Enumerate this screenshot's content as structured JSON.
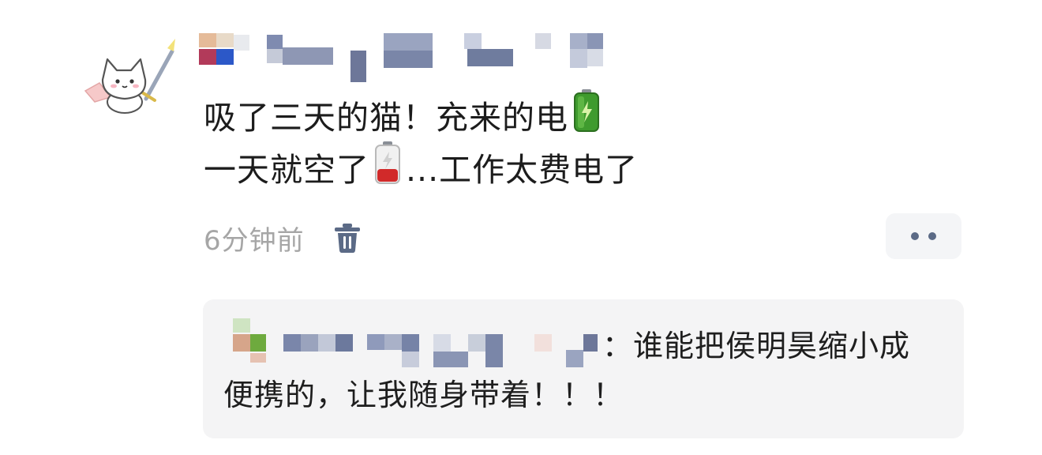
{
  "post": {
    "content_line1": "吸了三天的猫！充来的电",
    "content_line2_a": "一天就空了",
    "content_line2_b": "...工作太费电了",
    "timestamp": "6分钟前"
  },
  "icons": {
    "avatar": "cat-knight-avatar",
    "emoji_full": "battery-full-icon",
    "emoji_low": "battery-low-icon",
    "delete": "trash-icon",
    "more": "more-dots-icon"
  },
  "reply": {
    "text_line1": "：谁能把侯明昊缩小成",
    "text_line2": "便携的，让我随身带着！！！"
  },
  "colors": {
    "timestamp": "#a6a6a6",
    "accent_icon": "#5b6a86",
    "reply_bg": "#f4f4f5"
  }
}
